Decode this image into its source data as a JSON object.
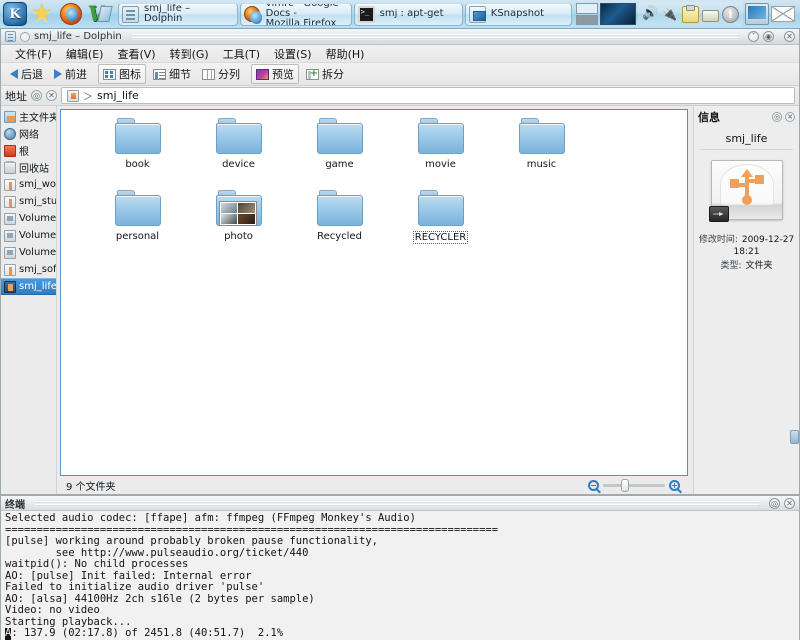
{
  "taskbar": {
    "launchers": [
      {
        "name": "kde-menu-button",
        "label": "K"
      },
      {
        "name": "favorites-star-icon",
        "label": "★"
      },
      {
        "name": "firefox-launcher-icon",
        "label": "Firefox"
      },
      {
        "name": "virtualbox-launcher-icon",
        "label": "VirtualBox"
      }
    ],
    "tasks": [
      {
        "label": "smj_life – Dolphin",
        "icon": "dolphin-icon",
        "active": true
      },
      {
        "label": "vimrc - Google Docs -\nMozilla Firefox",
        "icon": "firefox-icon",
        "active": false
      },
      {
        "label": "smj : apt-get",
        "icon": "terminal-icon",
        "active": false
      },
      {
        "label": "KSnapshot",
        "icon": "ksnapshot-icon",
        "active": false
      }
    ],
    "tray": [
      {
        "name": "volume-icon"
      },
      {
        "name": "plug-icon"
      },
      {
        "name": "clipboard-icon"
      },
      {
        "name": "printer-icon"
      },
      {
        "name": "info-icon",
        "label": "i"
      }
    ],
    "right": [
      {
        "name": "network-monitor-icon"
      },
      {
        "name": "mail-icon"
      }
    ]
  },
  "dolphin": {
    "title": "smj_life – Dolphin",
    "window_buttons": [
      {
        "name": "minimize-button",
        "glyph": "˅"
      },
      {
        "name": "maximize-button",
        "glyph": "◉"
      },
      {
        "name": "close-button",
        "glyph": "✕"
      }
    ],
    "menu": [
      "文件(F)",
      "编辑(E)",
      "查看(V)",
      "转到(G)",
      "工具(T)",
      "设置(S)",
      "帮助(H)"
    ],
    "toolbar": [
      {
        "label": "后退",
        "icon": "back-arrow-icon"
      },
      {
        "label": "前进",
        "icon": "forward-arrow-icon"
      },
      {
        "label": "图标",
        "icon": "icons-view-icon"
      },
      {
        "label": "细节",
        "icon": "details-view-icon"
      },
      {
        "label": "分列",
        "icon": "columns-view-icon"
      },
      {
        "label": "预览",
        "icon": "preview-icon"
      },
      {
        "label": "拆分",
        "icon": "split-view-icon"
      }
    ],
    "location": {
      "label": "地址",
      "controls": [
        {
          "name": "location-edit-toggle",
          "glyph": "◎"
        },
        {
          "name": "location-clear-button",
          "glyph": "✕"
        }
      ],
      "breadcrumb_icon": "usb-drive-icon",
      "separator": "＞",
      "path": "smj_life"
    },
    "places": [
      {
        "label": "主文件夹",
        "icon": "home-folder-icon",
        "selected": false
      },
      {
        "label": "网络",
        "icon": "network-icon",
        "selected": false
      },
      {
        "label": "根",
        "icon": "root-folder-icon",
        "selected": false
      },
      {
        "label": "回收站",
        "icon": "trash-icon",
        "selected": false
      },
      {
        "label": "smj_work",
        "icon": "usb-volume-icon",
        "selected": false
      },
      {
        "label": "smj_study",
        "icon": "usb-volume-icon",
        "selected": false
      },
      {
        "label": "Volume ···",
        "icon": "volume-icon",
        "selected": false
      },
      {
        "label": "Volume ···",
        "icon": "volume-icon",
        "selected": false
      },
      {
        "label": "Volume ···",
        "icon": "volume-icon",
        "selected": false
      },
      {
        "label": "smj_soft",
        "icon": "usb-volume-icon",
        "selected": false
      },
      {
        "label": "smj_life",
        "icon": "usb-volume-icon",
        "selected": true
      }
    ],
    "files": [
      {
        "name": "book",
        "icon": "folder-icon",
        "focused": false
      },
      {
        "name": "device",
        "icon": "folder-icon",
        "focused": false
      },
      {
        "name": "game",
        "icon": "folder-icon",
        "focused": false
      },
      {
        "name": "movie",
        "icon": "folder-icon",
        "focused": false
      },
      {
        "name": "music",
        "icon": "folder-icon",
        "focused": false
      },
      {
        "name": "personal",
        "icon": "folder-icon",
        "focused": false
      },
      {
        "name": "photo",
        "icon": "folder-with-previews-icon",
        "focused": false
      },
      {
        "name": "Recycled",
        "icon": "folder-icon",
        "focused": false
      },
      {
        "name": "RECYCLER",
        "icon": "folder-icon",
        "focused": true
      }
    ],
    "status": "9 个文件夹",
    "zoom": {
      "out_icon": "zoom-out-icon",
      "in_icon": "zoom-in-icon"
    },
    "info": {
      "title": "信息",
      "controls": [
        {
          "name": "info-settings-button",
          "glyph": "◎"
        },
        {
          "name": "info-close-button",
          "glyph": "✕"
        }
      ],
      "name": "smj_life",
      "thumb_icon": "usb-drive-icon",
      "meta": [
        {
          "key": "修改时间:",
          "value": "2009-12-27",
          "value2": "18:21"
        },
        {
          "key": "类型:",
          "value": "文件夹",
          "value2": ""
        }
      ]
    }
  },
  "konsole": {
    "title": "终端",
    "window_buttons": [
      {
        "name": "konsole-float-button",
        "glyph": "◎"
      },
      {
        "name": "konsole-close-button",
        "glyph": "✕"
      }
    ],
    "output": "Selected audio codec: [ffape] afm: ffmpeg (FFmpeg Monkey's Audio)\n==============================================================================\n[pulse] working around probably broken pause functionality,\n        see http://www.pulseaudio.org/ticket/440\nwaitpid(): No child processes\nAO: [pulse] Init failed: Internal error\nFailed to initialize audio driver 'pulse'\nAO: [alsa] 44100Hz 2ch s16le (2 bytes per sample)\nVideo: no video\nStarting playback...\n",
    "status_line_cursor": "A",
    "status_line": ": 137.9 (02:17.8) of 2451.8 (40:51.7)  2.1%"
  },
  "colors": {
    "taskbar_accent": "#9fd0e8",
    "selection": "#2f7cc4",
    "folder": "#9fcbe9",
    "usb_orange": "#f0a05a"
  }
}
